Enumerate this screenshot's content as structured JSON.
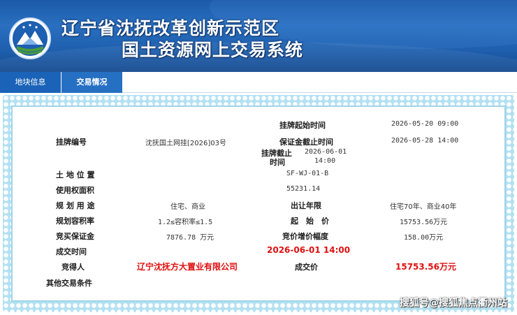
{
  "header": {
    "title_line1": "辽宁省沈抚改革创新示范区",
    "title_line2": "国土资源网上交易系统"
  },
  "tabs": [
    {
      "label": "地块信息"
    },
    {
      "label": "交易情况"
    }
  ],
  "fields": {
    "listing_start_label": "挂牌起始时间",
    "listing_start_value": "2026-05-20 09:00",
    "deposit_deadline_label": "保证金截止时间",
    "deposit_deadline_value": "2026-05-28 14:00",
    "listing_no_label": "挂牌编号",
    "listing_no_value": "沈抚国土网挂[2026]03号",
    "listing_end_label_a": "挂牌截止",
    "listing_end_label_b": "时间",
    "listing_end_value_a": "2026-06-01",
    "listing_end_value_b": "14:00",
    "location_label": "土 地 位 置",
    "location_value": "SF-WJ-01-B",
    "area_label": "使用权面积",
    "area_value": "55231.14",
    "usage_label": "规 划 用 途",
    "usage_value": "住宅、商业",
    "term_label": "出让年限",
    "term_value": "住宅70年、商业40年",
    "far_label": "规划容积率",
    "far_value": "1.2≤容积率≤1.5",
    "start_price_label": "起　始　价",
    "start_price_value": "15753.56万元",
    "bid_deposit_label": "竞买保证金",
    "bid_deposit_value": "7876.78 万元",
    "increment_label": "竞价增价幅度",
    "increment_value": "158.00万元",
    "deal_time_label": "成交时间",
    "deal_time_value": "2026-06-01 14:00",
    "winner_label": "竞得人",
    "winner_value": "辽宁沈抚方大置业有限公司",
    "deal_price_label": "成交价",
    "deal_price_value": "15753.56万元",
    "other_label": "其他交易条件"
  },
  "watermark": "搜狐号@搜狐焦点衢州站",
  "colors": {
    "header_blue": "#1b5aa8",
    "tab_blue": "#1a63b8",
    "frame_blue": "#b3e1f2",
    "highlight_red": "#e01010"
  }
}
